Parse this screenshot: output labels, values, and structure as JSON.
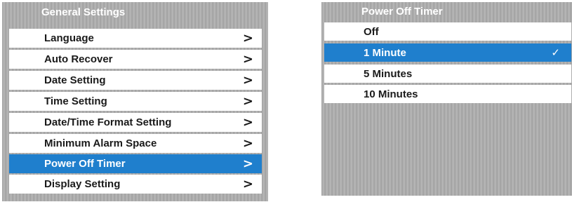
{
  "general_settings": {
    "title": "General Settings",
    "items": [
      {
        "label": "Language",
        "chevron": ">"
      },
      {
        "label": "Auto Recover",
        "chevron": ">"
      },
      {
        "label": "Date Setting",
        "chevron": ">"
      },
      {
        "label": "Time Setting",
        "chevron": ">"
      },
      {
        "label": "Date/Time Format Setting",
        "chevron": ">"
      },
      {
        "label": "Minimum Alarm Space",
        "chevron": ">"
      },
      {
        "label": "Power Off Timer",
        "chevron": ">",
        "selected": true
      },
      {
        "label": "Display Setting",
        "chevron": ">"
      }
    ]
  },
  "power_off_timer": {
    "title": "Power Off Timer",
    "options": [
      {
        "label": "Off"
      },
      {
        "label": "1 Minute",
        "selected": true,
        "check": "✓"
      },
      {
        "label": "5 Minutes"
      },
      {
        "label": "10 Minutes"
      }
    ]
  },
  "colors": {
    "selection_blue": "#1f7fcd",
    "row_background": "#ffffff",
    "panel_background": "#acacac",
    "header_text": "#ffffff"
  }
}
